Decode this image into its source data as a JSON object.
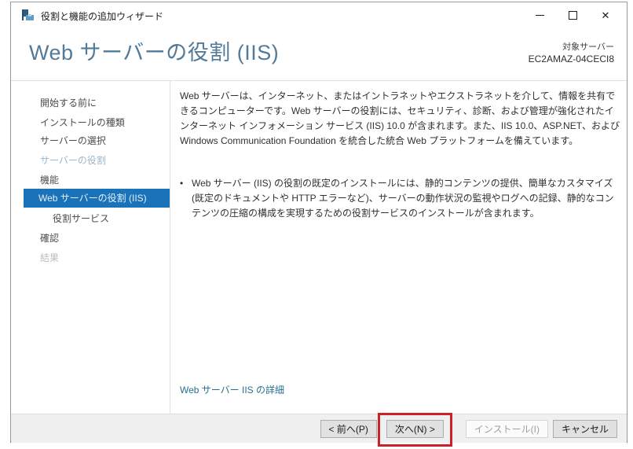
{
  "window": {
    "title": "役割と機能の追加ウィザード",
    "controls": {
      "minimize_glyph": "—",
      "maximize_glyph": "□",
      "close_glyph": "✕"
    }
  },
  "header": {
    "page_title": "Web サーバーの役割 (IIS)",
    "target_server_label": "対象サーバー",
    "target_server_name": "EC2AMAZ-04CECI8"
  },
  "sidebar": {
    "items": [
      {
        "label": "開始する前に",
        "state": "normal"
      },
      {
        "label": "インストールの種類",
        "state": "normal"
      },
      {
        "label": "サーバーの選択",
        "state": "normal"
      },
      {
        "label": "サーバーの役割",
        "state": "visited"
      },
      {
        "label": "機能",
        "state": "normal"
      },
      {
        "label": "Web サーバーの役割 (IIS)",
        "state": "current"
      },
      {
        "label": "役割サービス",
        "state": "child"
      },
      {
        "label": "確認",
        "state": "normal"
      },
      {
        "label": "結果",
        "state": "disabled"
      }
    ]
  },
  "content": {
    "intro_text": "Web サーバーは、インターネット、またはイントラネットやエクストラネットを介して、情報を共有できるコンピューターです。Web サーバーの役割には、セキュリティ、診断、および管理が強化されたインターネット インフォメーション サービス (IIS) 10.0 が含まれます。また、IIS 10.0、ASP.NET、および Windows Communication Foundation を統合した統合 Web プラットフォームを備えています。",
    "bullet_marker": "•",
    "bullet_text": "Web サーバー (IIS) の役割の既定のインストールには、静的コンテンツの提供、簡単なカスタマイズ (既定のドキュメントや HTTP エラーなど)、サーバーの動作状況の監視やログへの記録、静的なコンテンツの圧縮の構成を実現するための役割サービスのインストールが含まれます。",
    "link_text": "Web サーバー IIS の詳細"
  },
  "footer": {
    "prev_label": "< 前へ(P)",
    "next_label": "次へ(N) >",
    "install_label": "インストール(I)",
    "cancel_label": "キャンセル"
  },
  "colors": {
    "accent_blue": "#1a72b8",
    "title_blue": "#527a99",
    "link_blue": "#29708f",
    "annotation_red": "#cb2128",
    "footer_gray": "#f0f0f0"
  }
}
